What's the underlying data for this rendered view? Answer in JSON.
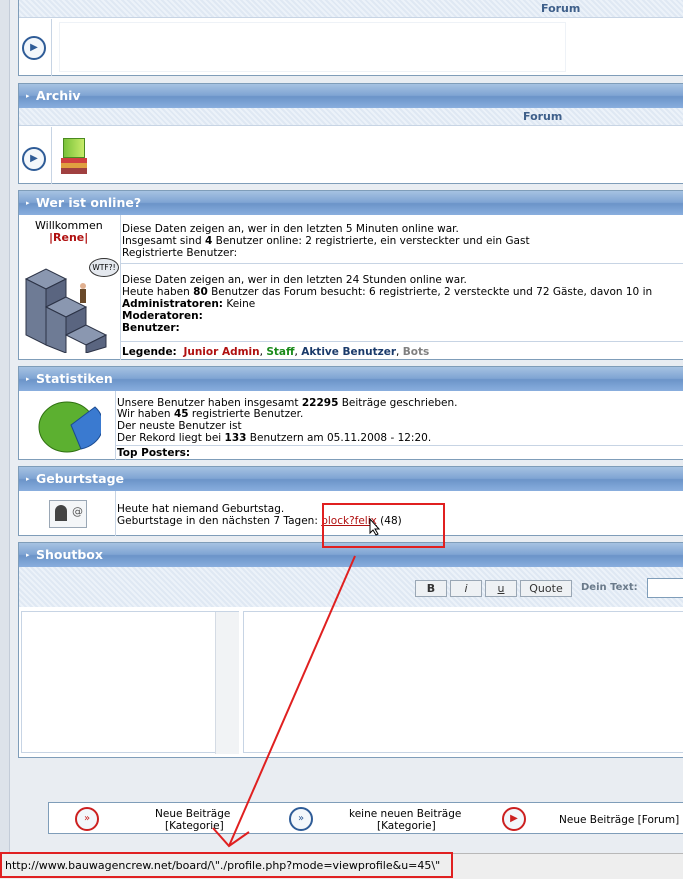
{
  "top_forum": {
    "column_label": "Forum"
  },
  "archiv": {
    "title": "Archiv",
    "column_label": "Forum"
  },
  "online": {
    "title": "Wer ist online?",
    "welcome": "Willkommen",
    "username": "|Rene|",
    "speech": "WTF?!",
    "line1": "Diese Daten zeigen an, wer in den letzten 5 Minuten online war.",
    "line2_pre": "Insgesamt sind ",
    "line2_count": "4",
    "line2_post": " Benutzer online: 2 registrierte, ein versteckter und ein Gast",
    "line3": "Registrierte Benutzer:",
    "line4": "Diese Daten zeigen an, wer in den letzten 24 Stunden online war.",
    "line5_pre": "Heute haben ",
    "line5_count": "80",
    "line5_post": " Benutzer das Forum besucht: 6 registrierte, 2 versteckte und 72 Gäste, davon 10 in",
    "admins_label": "Administratoren:",
    "admins_value": " Keine",
    "mods_label": "Moderatoren:",
    "users_label": "Benutzer:",
    "legend_label": "Legende:",
    "legend_junior": "Junior Admin",
    "legend_staff": "Staff",
    "legend_active": "Aktive Benutzer",
    "legend_bots": "Bots",
    "sep": ", "
  },
  "stats": {
    "title": "Statistiken",
    "l1_pre": "Unsere Benutzer haben insgesamt ",
    "l1_count": "22295",
    "l1_post": " Beiträge geschrieben.",
    "l2_pre": "Wir haben ",
    "l2_count": "45",
    "l2_post": " registrierte Benutzer.",
    "l3": "Der neuste Benutzer ist",
    "l4_pre": "Der Rekord liegt bei ",
    "l4_count": "133",
    "l4_post": " Benutzern am 05.11.2008 - 12:20.",
    "top_posters": "Top Posters:"
  },
  "birthdays": {
    "title": "Geburtstage",
    "today": "Heute hat niemand Geburtstag.",
    "next_pre": "Geburtstage in den nächsten 7 Tagen: ",
    "next_user": "block?felix",
    "next_age": " (48)"
  },
  "shoutbox": {
    "title": "Shoutbox",
    "bold": "B",
    "italic": "i",
    "underline": "u",
    "quote": "Quote",
    "text_label": "Dein Text:"
  },
  "footer_legend": {
    "new_posts": "Neue Beiträge",
    "new_posts_sub": "[Kategorie]",
    "no_new": "keine neuen Beiträge",
    "no_new_sub": "[Kategorie]",
    "new_forum": "Neue Beiträge [Forum]"
  },
  "status": {
    "url": "http://www.bauwagencrew.net/board/\\\"./profile.php?mode=viewprofile&u=45\\\""
  },
  "colors": {
    "junior": "#b01010",
    "staff": "#1a8a1a",
    "active": "#1a3a6a",
    "bots": "#808080",
    "annot": "#e02020"
  }
}
